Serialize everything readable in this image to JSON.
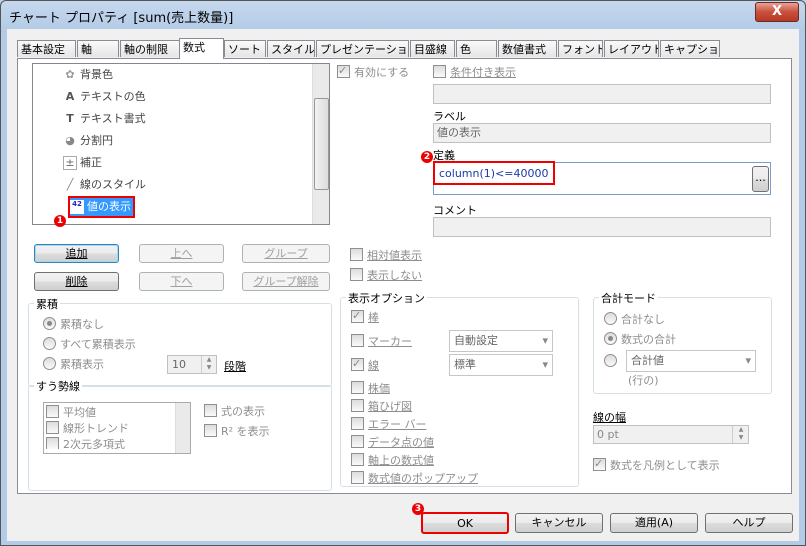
{
  "window": {
    "title": "チャート プロパティ [sum(売上数量)]",
    "close_label": "X"
  },
  "tabs": [
    {
      "label": "基本設定"
    },
    {
      "label": "軸"
    },
    {
      "label": "軸の制限"
    },
    {
      "label": "数式"
    },
    {
      "label": "ソート"
    },
    {
      "label": "スタイル"
    },
    {
      "label": "プレゼンテーション"
    },
    {
      "label": "目盛線"
    },
    {
      "label": "色"
    },
    {
      "label": "数値書式"
    },
    {
      "label": "フォント"
    },
    {
      "label": "レイアウト"
    },
    {
      "label": "キャプション"
    }
  ],
  "attr_list": {
    "items": [
      {
        "label": "背景色",
        "icon": "palette-icon"
      },
      {
        "label": "テキストの色",
        "icon": "text-color-icon"
      },
      {
        "label": "テキスト書式",
        "icon": "text-format-icon"
      },
      {
        "label": "分割円",
        "icon": "pie-split-icon"
      },
      {
        "label": "補正",
        "icon": "correction-icon"
      },
      {
        "label": "線のスタイル",
        "icon": "line-style-icon"
      },
      {
        "label": "値の表示",
        "icon": "value-display-icon"
      }
    ],
    "icon_glyphs": [
      "✿",
      "A",
      "T",
      "◕",
      "±",
      "╱",
      "42"
    ]
  },
  "buttons": {
    "add": "追加",
    "up": "上へ",
    "group": "グループ",
    "delete": "削除",
    "down": "下へ",
    "ungroup": "グループ解除"
  },
  "right": {
    "enable": "有効にする",
    "conditional": "条件付き表示",
    "label_caption": "ラベル",
    "label_value": "値の表示",
    "def_caption": "定義",
    "def_value": "column(1)<=40000",
    "dots": "...",
    "comment_caption": "コメント"
  },
  "cumulative": {
    "title": "累積",
    "options": [
      "累積なし",
      "すべて累積表示",
      "累積表示"
    ],
    "steps_value": "10",
    "steps_label": "段階"
  },
  "trend": {
    "title": "すう勢線",
    "items": [
      "平均値",
      "線形トレンド",
      "2次元多項式"
    ],
    "show_formula": "式の表示",
    "show_r2": "R² を表示"
  },
  "mid": {
    "relative": "相対値表示",
    "invisible": "表示しない",
    "display_title": "表示オプション",
    "options": [
      "棒",
      "マーカー",
      "線",
      "株価",
      "箱ひげ図",
      "エラー バー",
      "データ点の値",
      "軸上の数式値",
      "数式値のポップアップ"
    ],
    "marker_combo": "自動設定",
    "line_combo": "標準"
  },
  "total": {
    "title": "合計モード",
    "options": [
      "合計なし",
      "数式の合計"
    ],
    "combo": "合計値",
    "row_label": "(行の)"
  },
  "width": {
    "title": "線の幅",
    "value": "0 pt"
  },
  "legend_formula": "数式を凡例として表示",
  "footer": {
    "ok": "OK",
    "cancel": "キャンセル",
    "apply": "適用(A)",
    "help": "ヘルプ"
  },
  "markers": [
    "1",
    "2",
    "3"
  ],
  "colors": {
    "highlight": "#e00000",
    "selection": "#3399ff"
  }
}
